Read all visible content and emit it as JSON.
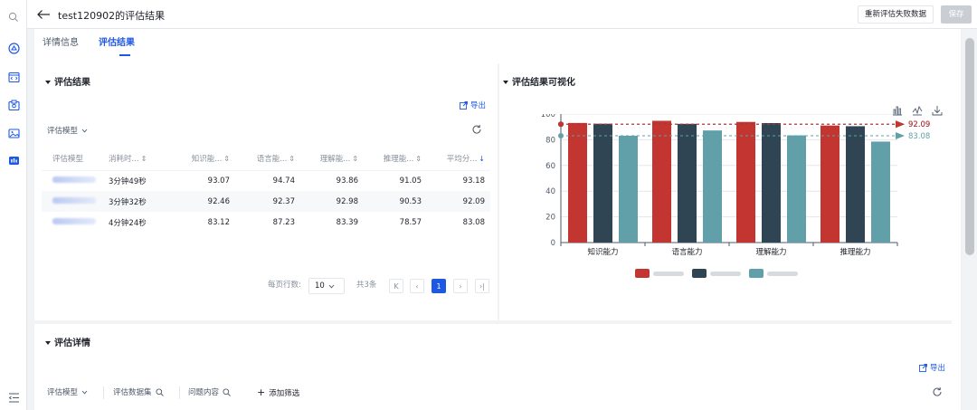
{
  "header": {
    "title": "test120902的评估结果",
    "rerun_button": "重新评估失败数据",
    "save_button": "保存"
  },
  "tabs": [
    {
      "label": "详情信息",
      "active": false
    },
    {
      "label": "评估结果",
      "active": true
    }
  ],
  "results_section": {
    "title": "评估结果",
    "export_label": "导出",
    "model_select": "评估模型",
    "columns": [
      "评估模型",
      "消耗时...",
      "知识能...",
      "语言能...",
      "理解能...",
      "推理能...",
      "平均分..."
    ],
    "rows": [
      {
        "model": "",
        "time": "3分钟49秒",
        "knowledge": "93.07",
        "language": "94.74",
        "comprehension": "93.86",
        "reasoning": "91.05",
        "average": "93.18"
      },
      {
        "model": "",
        "time": "3分钟32秒",
        "knowledge": "92.46",
        "language": "92.37",
        "comprehension": "92.98",
        "reasoning": "90.53",
        "average": "92.09"
      },
      {
        "model": "",
        "time": "4分钟24秒",
        "knowledge": "83.12",
        "language": "87.23",
        "comprehension": "83.39",
        "reasoning": "78.57",
        "average": "83.08"
      }
    ],
    "pagination": {
      "page_size_label": "每页行数:",
      "page_size": "10",
      "total_label": "共3条",
      "current_page": "1"
    }
  },
  "visual_section": {
    "title": "评估结果可视化"
  },
  "chart_data": {
    "type": "bar",
    "categories": [
      "知识能力",
      "语言能力",
      "理解能力",
      "推理能力"
    ],
    "series": [
      {
        "values": [
          93.07,
          94.74,
          93.86,
          91.05
        ],
        "color": "#c23531"
      },
      {
        "values": [
          92.46,
          92.37,
          92.98,
          90.53
        ],
        "color": "#2f4554"
      },
      {
        "values": [
          83.12,
          87.23,
          83.39,
          78.57
        ],
        "color": "#61a0a8"
      }
    ],
    "ylim": [
      0,
      100
    ],
    "yticks": [
      "0",
      "20",
      "40",
      "60",
      "80",
      "100"
    ],
    "mark_lines": [
      {
        "label": "92.09",
        "value": 92.09,
        "color": "#2f4554"
      },
      {
        "label": "92.09",
        "value": 92.09,
        "color": "#c23531"
      },
      {
        "label": "83.08",
        "value": 83.08,
        "color": "#61a0a8"
      }
    ],
    "grid": true,
    "legend_position": "bottom"
  },
  "details_section": {
    "title": "评估详情",
    "export_label": "导出",
    "filters": [
      "评估模型",
      "评估数据集",
      "问题内容"
    ],
    "add_filter": "添加筛选"
  },
  "icons": {
    "back": "arrow-left-icon",
    "export": "external-link-icon",
    "refresh": "refresh-icon",
    "chart_bar": "bar-chart-icon",
    "chart_line": "line-chart-icon",
    "download": "download-icon"
  }
}
